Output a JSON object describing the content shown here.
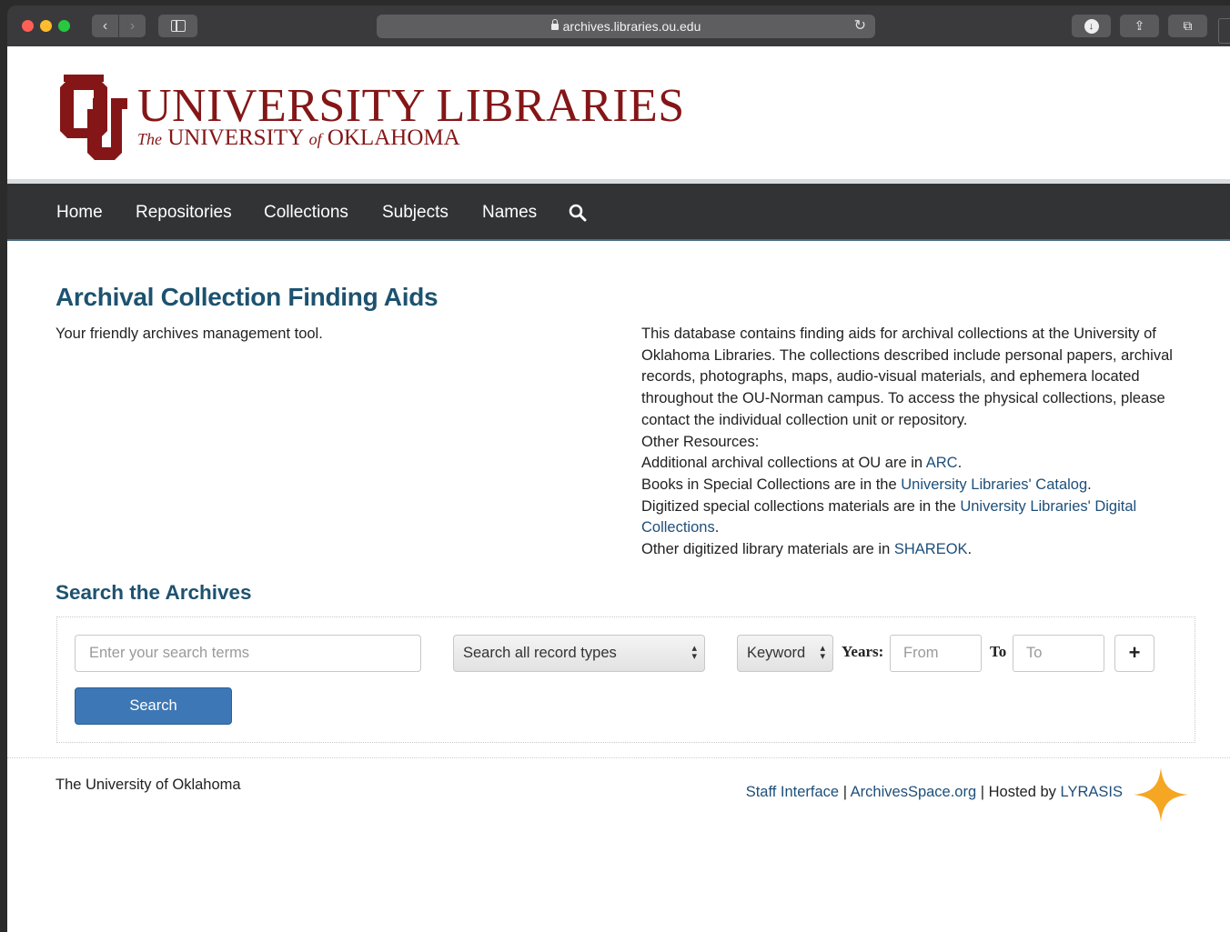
{
  "browser": {
    "url": "archives.libraries.ou.edu",
    "back_glyph": "‹",
    "forward_glyph": "›",
    "reload_glyph": "↻",
    "download_glyph": "↓",
    "share_glyph": "⇪",
    "tabs_glyph": "⧉"
  },
  "header": {
    "logo_title": "UNIVERSITY LIBRARIES",
    "logo_sub_the": "The",
    "logo_sub_university": "UNIVERSITY",
    "logo_sub_of": "of",
    "logo_sub_oklahoma": "OKLAHOMA",
    "brand_color": "#841617"
  },
  "nav": {
    "items": [
      {
        "label": "Home"
      },
      {
        "label": "Repositories"
      },
      {
        "label": "Collections"
      },
      {
        "label": "Subjects"
      },
      {
        "label": "Names"
      }
    ],
    "search_icon": "search-icon"
  },
  "main": {
    "title": "Archival Collection Finding Aids",
    "tagline": "Your friendly archives management tool.",
    "description": {
      "intro": "This database contains finding aids for archival collections at the University of Oklahoma Libraries. The collections described include personal papers, archival records, photographs, maps, audio-visual materials, and ephemera located throughout the OU-Norman campus. To access the physical collections, please contact the individual collection unit or repository.",
      "other_resources": "Other Resources:",
      "line1_prefix": "Additional archival collections at OU are in ",
      "line1_link": "ARC",
      "line2_prefix": "Books in Special Collections are in the ",
      "line2_link": "University Libraries' Catalog",
      "line3_prefix": "Digitized special collections materials are in the ",
      "line3_link": "University Libraries' Digital Collections",
      "line4_prefix": "Other digitized library materials are in ",
      "line4_link": "SHAREOK",
      "period": "."
    }
  },
  "search": {
    "title": "Search the Archives",
    "input_placeholder": "Enter your search terms",
    "record_type_selected": "Search all record types",
    "field_selected": "Keyword",
    "years_label": "Years:",
    "from_placeholder": "From",
    "to_label": "To",
    "to_placeholder": "To",
    "add_label": "+",
    "button_label": "Search"
  },
  "footer": {
    "left": "The University of Oklahoma",
    "staff_link": "Staff Interface",
    "sep1": " | ",
    "archivesspace_link": "ArchivesSpace.org",
    "hosted_prefix": " | Hosted by ",
    "lyrasis_link": "LYRASIS"
  },
  "colors": {
    "link": "#1e4f7a",
    "heading": "#1d5270",
    "navbar": "#323334",
    "search_button": "#3d77b5",
    "star": "#f5a623"
  }
}
